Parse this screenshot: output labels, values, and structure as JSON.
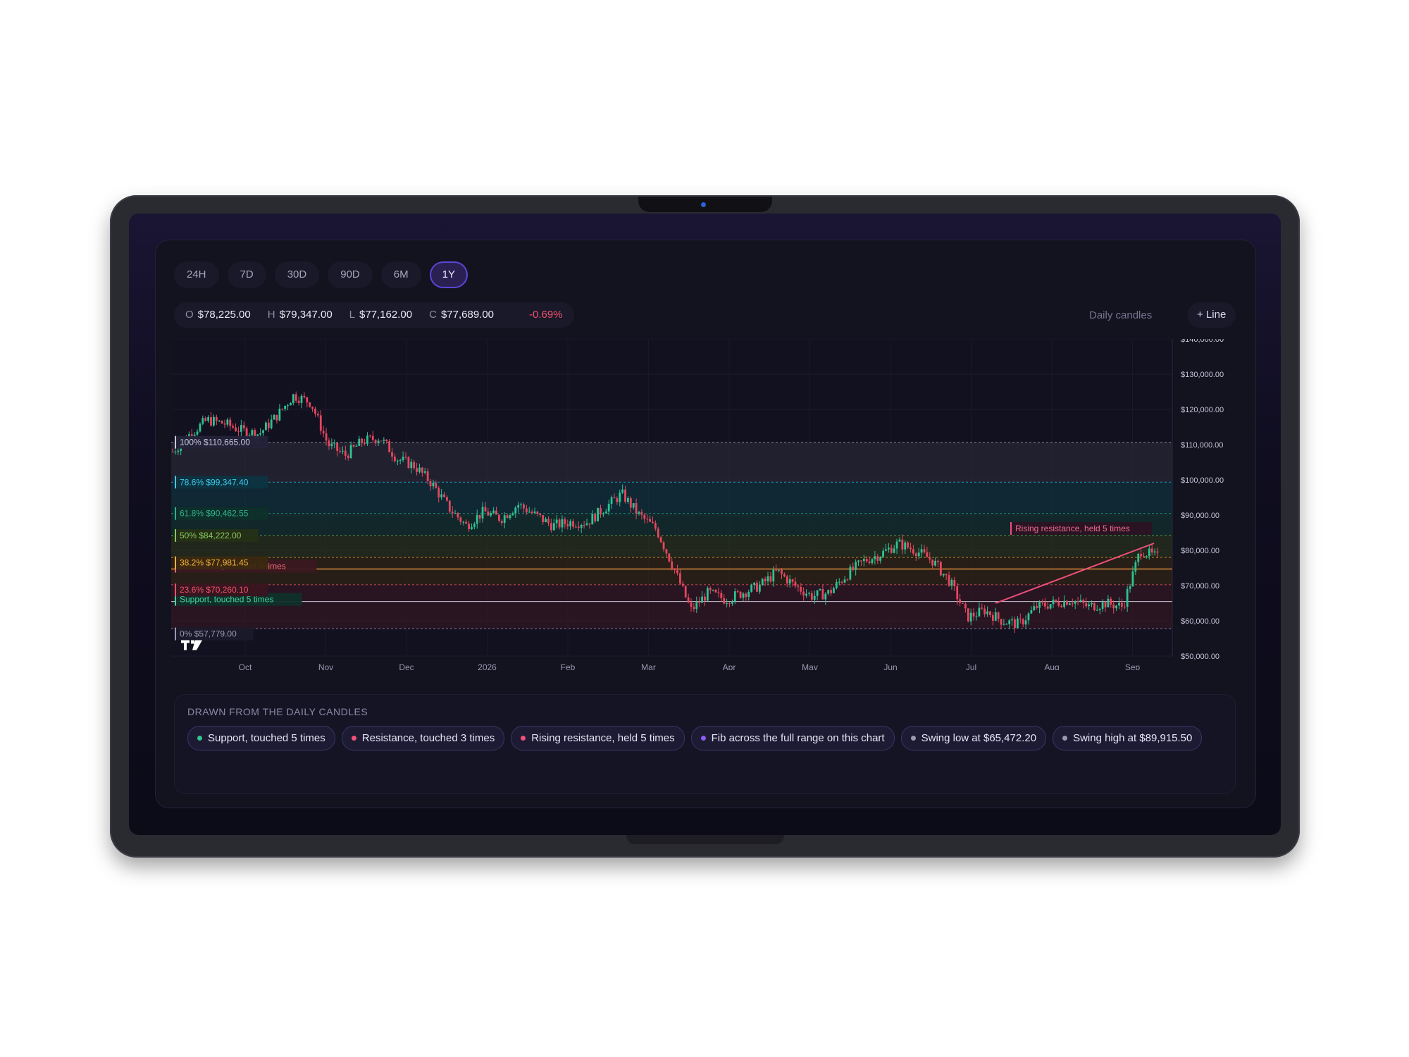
{
  "tabs": [
    "24H",
    "7D",
    "30D",
    "90D",
    "6M",
    "1Y"
  ],
  "active_tab": "1Y",
  "ohlc": {
    "o_label": "O",
    "o": "$78,225.00",
    "h_label": "H",
    "h": "$79,347.00",
    "l_label": "L",
    "l": "$77,162.00",
    "c_label": "C",
    "c": "$77,689.00",
    "change": "-0.69%"
  },
  "toolbar": {
    "candles_label": "Daily candles",
    "line_button": "+ Line"
  },
  "chart_data": {
    "type": "candlestick",
    "interval": "daily",
    "ylim": [
      50000,
      140000
    ],
    "yticks": [
      "$140,000.00",
      "$130,000.00",
      "$120,000.00",
      "$110,000.00",
      "$100,000.00",
      "$90,000.00",
      "$80,000.00",
      "$70,000.00",
      "$60,000.00",
      "$50,000.00"
    ],
    "xticks": [
      "Oct",
      "Nov",
      "Dec",
      "2026",
      "Feb",
      "Mar",
      "Apr",
      "May",
      "Jun",
      "Jul",
      "Aug",
      "Sep"
    ],
    "close_path": [
      [
        "Sep",
        108000
      ],
      [
        "",
        113000
      ],
      [
        "",
        117000
      ],
      [
        "",
        116000
      ],
      [
        "",
        114000
      ],
      [
        "",
        113000
      ],
      [
        "Oct",
        118000
      ],
      [
        "",
        124000
      ],
      [
        "",
        122000
      ],
      [
        "",
        110000
      ],
      [
        "",
        107000
      ],
      [
        "",
        111000
      ],
      [
        "Nov",
        112000
      ],
      [
        "",
        106000
      ],
      [
        "",
        104000
      ],
      [
        "",
        99000
      ],
      [
        "",
        92000
      ],
      [
        "",
        87000
      ],
      [
        "Dec",
        91000
      ],
      [
        "",
        89000
      ],
      [
        "",
        93000
      ],
      [
        "",
        90000
      ],
      [
        "",
        87000
      ],
      [
        "",
        88000
      ],
      [
        "2026",
        88000
      ],
      [
        "",
        92000
      ],
      [
        "",
        96000
      ],
      [
        "",
        90000
      ],
      [
        "Feb",
        86000
      ],
      [
        "",
        75000
      ],
      [
        "",
        63000
      ],
      [
        "",
        68000
      ],
      [
        "",
        66000
      ],
      [
        "Mar",
        68000
      ],
      [
        "",
        70000
      ],
      [
        "",
        74000
      ],
      [
        "",
        70000
      ],
      [
        "",
        67000
      ],
      [
        "Apr",
        68000
      ],
      [
        "",
        73000
      ],
      [
        "",
        77000
      ],
      [
        "",
        79000
      ],
      [
        "May",
        82000
      ],
      [
        "",
        80000
      ],
      [
        "",
        77000
      ],
      [
        "",
        71000
      ],
      [
        "Jun",
        61000
      ],
      [
        "",
        63000
      ],
      [
        "",
        60000
      ],
      [
        "Jul",
        59000
      ],
      [
        "",
        64000
      ],
      [
        "",
        65000
      ],
      [
        "",
        66000
      ],
      [
        "Aug",
        64000
      ],
      [
        "",
        65000
      ],
      [
        "",
        64000
      ],
      [
        "",
        80000
      ],
      [
        "Sep",
        78000
      ]
    ],
    "fib_levels": [
      {
        "label": "100%",
        "price": "$110,665.00",
        "value": 110665,
        "color": "#9a98b0"
      },
      {
        "label": "78.6%",
        "price": "$99,347.40",
        "value": 99347.4,
        "color": "#22b6d8"
      },
      {
        "label": "61.8%",
        "price": "$90,462.55",
        "value": 90462.55,
        "color": "#1e9c7a"
      },
      {
        "label": "50%",
        "price": "$84,222.00",
        "value": 84222,
        "color": "#6aa84f"
      },
      {
        "label": "38.2%",
        "price": "$77,981.45",
        "value": 77981.45,
        "color": "#e3a02a"
      },
      {
        "label": "23.6%",
        "price": "$70,260.10",
        "value": 70260.1,
        "color": "#e14d5a"
      },
      {
        "label": "0%",
        "price": "$57,779.00",
        "value": 57779,
        "color": "#9a98b0"
      }
    ],
    "resistance": {
      "label": "Resistance, touched 3 times",
      "value": 74700,
      "color": "#e14d5a"
    },
    "support": {
      "label": "Support, touched 5 times",
      "value": 65472.2,
      "color": "#31c58f"
    },
    "rising_resistance": {
      "label": "Rising resistance, held 5 times",
      "start": 65000,
      "end": 82000,
      "color": "#f0507a"
    }
  },
  "footer": {
    "title": "DRAWN FROM THE DAILY CANDLES",
    "chips": [
      {
        "label": "Support, touched 5 times",
        "color": "#31c58f"
      },
      {
        "label": "Resistance, touched 3 times",
        "color": "#f0507a"
      },
      {
        "label": "Rising resistance, held 5 times",
        "color": "#f0507a"
      },
      {
        "label": "Fib across the full range on this chart",
        "color": "#8b5cf6"
      },
      {
        "label": "Swing low at $65,472.20",
        "color": "#9a98b0"
      },
      {
        "label": "Swing high at $89,915.50",
        "color": "#9a98b0"
      }
    ]
  }
}
